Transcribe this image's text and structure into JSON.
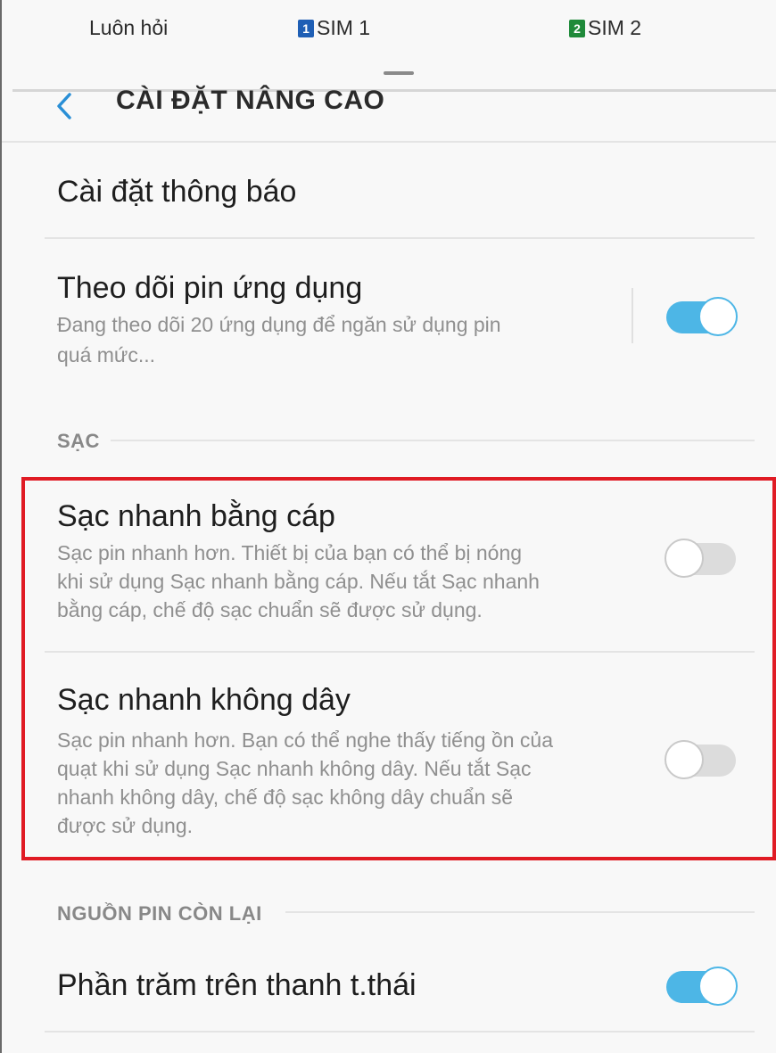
{
  "sim_bar": {
    "always_ask": "Luôn hỏi",
    "sim1": {
      "badge": "1",
      "label": "SIM 1",
      "color": "#1f5fb5"
    },
    "sim2": {
      "badge": "2",
      "label": "SIM 2",
      "color": "#1f8a3a"
    }
  },
  "header": {
    "title": "CÀI ĐẶT NÂNG CAO",
    "back_icon": "chevron-left-icon"
  },
  "items": {
    "notification_settings": {
      "title": "Cài đặt thông báo"
    },
    "app_battery_monitor": {
      "title": "Theo dõi pin ứng dụng",
      "subtitle_line1": "Đang theo dõi 20 ứng dụng để ngăn sử dụng pin",
      "subtitle_line2": "quá mức...",
      "enabled": true
    }
  },
  "sections": {
    "charging": {
      "label": "SẠC",
      "fast_cable": {
        "title": "Sạc nhanh bằng cáp",
        "lines": [
          "Sạc pin nhanh hơn. Thiết bị của bạn có thể bị nóng",
          "khi sử dụng Sạc nhanh bằng cáp. Nếu tắt Sạc nhanh",
          "bằng cáp, chế độ sạc chuẩn sẽ được sử dụng."
        ],
        "enabled": false
      },
      "fast_wireless": {
        "title": "Sạc nhanh không dây",
        "lines": [
          "Sạc pin nhanh hơn. Bạn có thể nghe thấy tiếng ồn của",
          "quạt khi sử dụng Sạc nhanh không dây. Nếu tắt Sạc",
          "nhanh không dây, chế độ sạc không dây chuẩn sẽ",
          "được sử dụng."
        ],
        "enabled": false
      }
    },
    "remaining_power": {
      "label": "NGUỒN PIN CÒN LẠI",
      "percent_status_bar": {
        "title": "Phần trăm trên thanh t.thái",
        "enabled": true
      }
    }
  },
  "colors": {
    "toggle_on": "#4db6e6",
    "toggle_off": "#dcdcdc",
    "highlight": "#e01b24"
  }
}
